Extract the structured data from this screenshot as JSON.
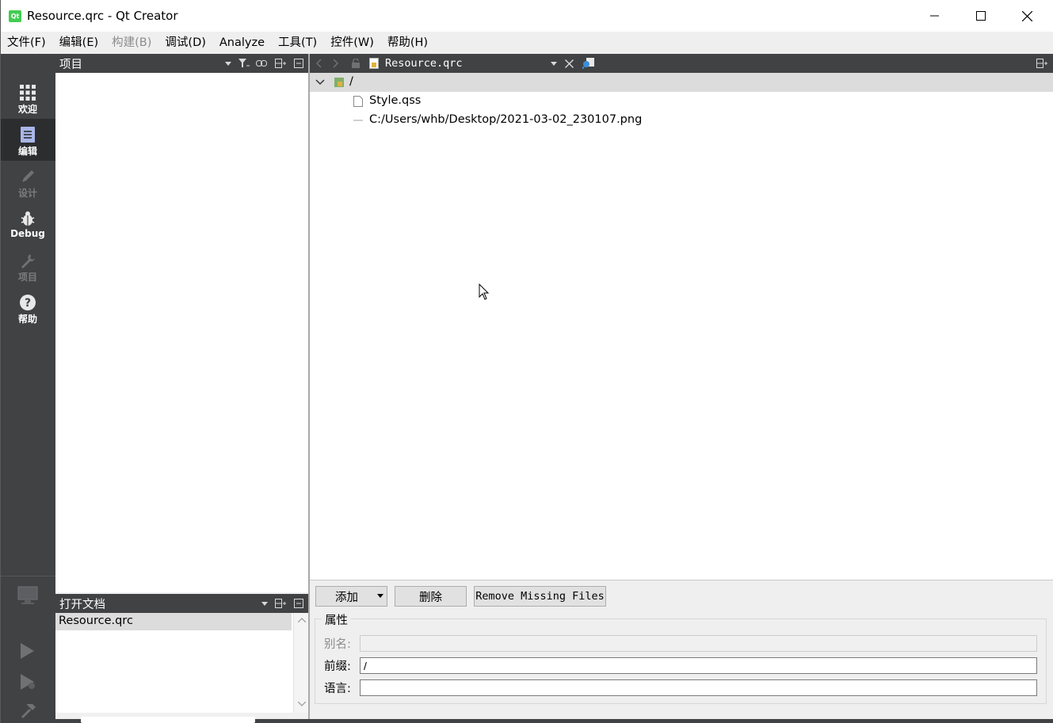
{
  "window": {
    "title": "Resource.qrc - Qt Creator",
    "app_icon_text": "Qt"
  },
  "menu": [
    {
      "label": "文件(F)",
      "enabled": true
    },
    {
      "label": "编辑(E)",
      "enabled": true
    },
    {
      "label": "构建(B)",
      "enabled": false
    },
    {
      "label": "调试(D)",
      "enabled": true
    },
    {
      "label": "Analyze",
      "enabled": true
    },
    {
      "label": "工具(T)",
      "enabled": true
    },
    {
      "label": "控件(W)",
      "enabled": true
    },
    {
      "label": "帮助(H)",
      "enabled": true
    }
  ],
  "modes": [
    {
      "label": "欢迎",
      "icon": "grid-icon",
      "active": false,
      "dim": false
    },
    {
      "label": "编辑",
      "icon": "document-icon",
      "active": true,
      "dim": false
    },
    {
      "label": "设计",
      "icon": "pencil-icon",
      "active": false,
      "dim": true
    },
    {
      "label": "Debug",
      "icon": "bug-icon",
      "active": false,
      "dim": false
    },
    {
      "label": "项目",
      "icon": "wrench-icon",
      "active": false,
      "dim": true
    },
    {
      "label": "帮助",
      "icon": "help-icon",
      "active": false,
      "dim": false
    }
  ],
  "project_pane": {
    "title": "项目"
  },
  "open_docs": {
    "title": "打开文档",
    "items": [
      "Resource.qrc"
    ]
  },
  "editor": {
    "document": "Resource.qrc"
  },
  "tree": {
    "root": "/",
    "children": [
      "Style.qss",
      "C:/Users/whb/Desktop/2021-03-02_230107.png"
    ]
  },
  "resource_panel": {
    "add_label": "添加",
    "delete_label": "删除",
    "remove_missing_label": "Remove Missing Files",
    "group_title": "属性",
    "alias_label": "别名:",
    "alias_value": "",
    "prefix_label": "前缀:",
    "prefix_value": "/",
    "lang_label": "语言:",
    "lang_value": ""
  },
  "colors": {
    "sidebar": "#404244",
    "sidebar_active": "#2c2d2f",
    "qt_green": "#41cd52"
  }
}
